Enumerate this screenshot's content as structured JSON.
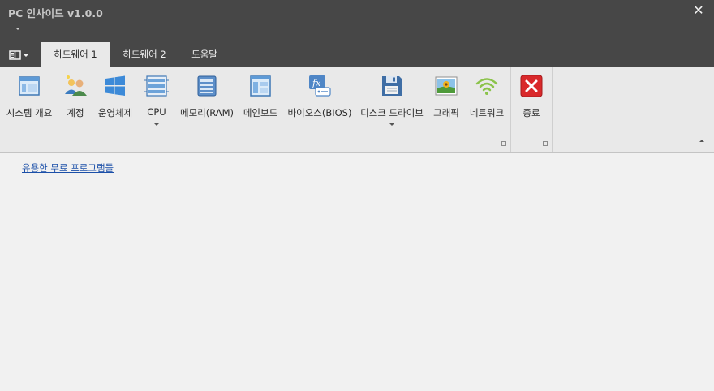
{
  "window": {
    "title": "PC 인사이드 v1.0.0",
    "close_glyph": "✕"
  },
  "tabs": [
    {
      "label": "하드웨어 1",
      "active": true
    },
    {
      "label": "하드웨어 2",
      "active": false
    },
    {
      "label": "도움말",
      "active": false
    }
  ],
  "ribbon": {
    "buttons": [
      {
        "label": "시스템 개요",
        "icon": "window-icon"
      },
      {
        "label": "계정",
        "icon": "users-icon"
      },
      {
        "label": "운영체제",
        "icon": "windows-logo-icon"
      },
      {
        "label": "CPU",
        "icon": "cpu-chip-icon",
        "dropdown": true
      },
      {
        "label": "메모리(RAM)",
        "icon": "memory-icon"
      },
      {
        "label": "메인보드",
        "icon": "mainboard-icon"
      },
      {
        "label": "바이오스(BIOS)",
        "icon": "bios-function-icon"
      },
      {
        "label": "디스크 드라이브",
        "icon": "floppy-disk-icon",
        "dropdown": true
      },
      {
        "label": "그래픽",
        "icon": "picture-icon"
      },
      {
        "label": "네트워크",
        "icon": "wifi-icon"
      }
    ],
    "exit_button": {
      "label": "종료",
      "icon": "exit-x-icon"
    }
  },
  "content": {
    "link_text": "유용한 무료 프로그램들"
  },
  "colors": {
    "titlebar": "#474747",
    "ribbon": "#e9e9e9",
    "body": "#f1f1f1",
    "link": "#1b4fa8",
    "exit": "#d9292b"
  }
}
